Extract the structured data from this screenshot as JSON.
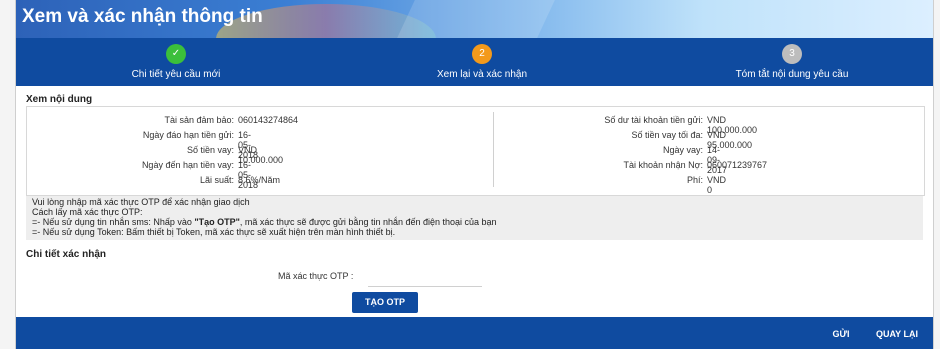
{
  "title": "Xem và xác nhận thông tin",
  "steps": [
    {
      "number": "✓",
      "label": "Chi tiết yêu cầu mới",
      "color": "#3bbf3b"
    },
    {
      "number": "2",
      "label": "Xem lại và xác nhận",
      "color": "#f39a1c"
    },
    {
      "number": "3",
      "label": "Tóm tắt nội dung yêu cầu",
      "color": "#bdbdbd"
    }
  ],
  "review": {
    "heading": "Xem nội dung",
    "left": [
      {
        "label": "Tài sản đảm bảo:",
        "value": "060143274864"
      },
      {
        "label": "Ngày đáo hạn tiền gửi:",
        "value": "16-05-2018"
      },
      {
        "label": "Số tiền vay:",
        "value": "VND 10.000.000"
      },
      {
        "label": "Ngày đến hạn tiền vay:",
        "value": "16-05-2018"
      },
      {
        "label": "Lãi suất:",
        "value": "8.6%/Năm"
      }
    ],
    "right": [
      {
        "label": "Số dư tài khoản tiền gửi:",
        "value": "VND 100.000.000"
      },
      {
        "label": "Số tiền vay tối đa:",
        "value": "VND 95.000.000"
      },
      {
        "label": "Ngày vay:",
        "value": "14-09-2017"
      },
      {
        "label": "Tài khoản nhận Nợ:",
        "value": "060071239767"
      },
      {
        "label": "Phí:",
        "value": "VND 0"
      }
    ]
  },
  "instructions": {
    "line1": "Vui lòng nhập mã xác thực OTP để xác nhận giao dịch",
    "line2": "Cách lấy mã xác thực OTP:",
    "line3_pre": "=- Nếu sử dụng tin nhắn sms: Nhấp vào ",
    "line3_bold": "\"Tạo OTP\"",
    "line3_post": ", mã xác thực sẽ được gửi bằng tin nhắn đến điện thoại của bạn",
    "line4": "=- Nếu sử dụng Token: Bấm thiết bị Token, mã xác thực sẽ xuất hiện trên màn hình thiết bị."
  },
  "confirm": {
    "heading": "Chi tiết xác nhận",
    "otp_label": "Mã xác thực OTP  :",
    "otp_value": "",
    "otp_button": "TẠO OTP"
  },
  "footer": {
    "send": "GỬI",
    "back": "QUAY LẠI"
  }
}
